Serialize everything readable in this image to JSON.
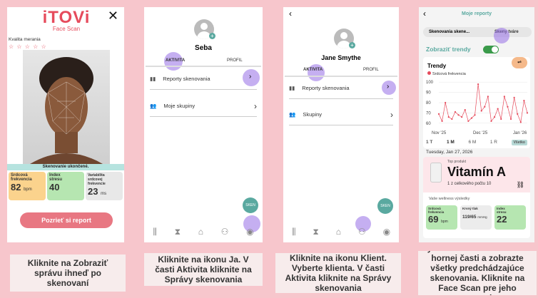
{
  "panel1": {
    "logo": "iTOVi",
    "logo_sub": "Face Scan",
    "quality_label": "Kvalita merania",
    "stars": "☆ ☆ ☆ ☆ ☆",
    "scan_done": "Skenovanie ukončené.",
    "metrics": [
      {
        "label": "Srdcová frekvencia",
        "value": "82",
        "unit": "bpm"
      },
      {
        "label": "Index stresu",
        "value": "40",
        "unit": ""
      },
      {
        "label": "Variabilita srdcovej frekvencie",
        "value": "23",
        "unit": "ms"
      }
    ],
    "button": "Pozrieť si report",
    "caption": "Kliknite na Zobraziť správu ihneď po skenovaní"
  },
  "panel2": {
    "name": "Seba",
    "tabs": [
      "AKTIVITA",
      "PROFIL"
    ],
    "menu": [
      "Reporty skenovania",
      "Moje skupiny"
    ],
    "fab": "SKEN",
    "caption": "Kliknite na ikonu Ja. V časti Aktivita kliknite na Správy skenovania"
  },
  "panel3": {
    "name": "Jane Smythe",
    "tabs": [
      "AKTIVITA",
      "PROFIL"
    ],
    "menu": [
      "Reporty skenovania",
      "Skupiny"
    ],
    "fab": "SKEN",
    "caption": "Kliknite na ikonu Klient. Vyberte klienta. V časti Aktivita kliknite na Správy skenovania"
  },
  "panel4": {
    "title": "Moje reporty",
    "tabs": [
      "Skenovania skene...",
      "Skeny tváre"
    ],
    "toggle_label": "Zobraziť trendy",
    "trend_title": "Trendy",
    "legend": "Srdcová frekvencia",
    "y_ticks": [
      "100",
      "90",
      "80",
      "70",
      "60"
    ],
    "x_ticks": [
      "Nov '25",
      "Dec '25",
      "Jan '26"
    ],
    "ranges": [
      "1 T",
      "1 M",
      "6 M",
      "1 R",
      "Všetko"
    ],
    "date": "Tuesday, Jan 27, 2026",
    "product_label": "Top produkt",
    "product": "Vitamín A",
    "product_sub": "1 z celkového počtu 10",
    "results_label": "Vaše wellness výsledky",
    "metrics": [
      {
        "label": "Srdcová frekvencia",
        "value": "69",
        "unit": "bpm"
      },
      {
        "label": "Krvný tlak",
        "value": "119/65",
        "unit": "mmHg"
      },
      {
        "label": "Index stresu",
        "value": "22",
        "unit": ""
      }
    ],
    "caption": "Vyberte kartu Face Scans v hornej časti a zobrazte všetky predchádzajúce skenovania. Kliknite na Face Scan pre jeho otvorenie"
  },
  "colors": {
    "accent": "#e64b5c",
    "ring": "#9b6fe6",
    "teal": "#5aa9a0"
  },
  "chart_data": {
    "type": "line",
    "title": "Trendy",
    "series": [
      {
        "name": "Srdcová frekvencia",
        "values": [
          69,
          62,
          80,
          66,
          64,
          71,
          68,
          66,
          73,
          62,
          65,
          68,
          98,
          72,
          76,
          86,
          62,
          66,
          74,
          64,
          86,
          76,
          64,
          85,
          69,
          61,
          82,
          70
        ]
      }
    ],
    "x": [
      "Nov '25",
      "Dec '25",
      "Jan '26"
    ],
    "ylim": [
      55,
      105
    ]
  }
}
